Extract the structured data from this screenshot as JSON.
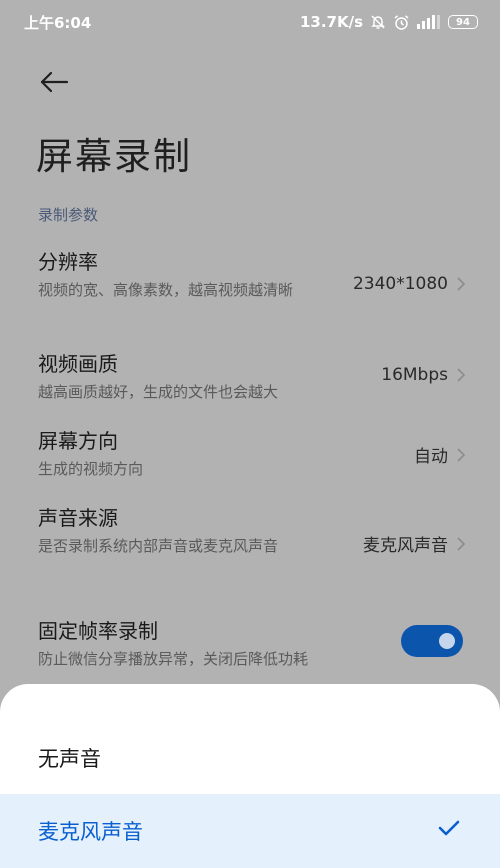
{
  "status_bar": {
    "time": "上午6:04",
    "network_speed": "13.7K/s",
    "battery_level": "94",
    "icons": [
      "muted-bell-icon",
      "alarm-icon",
      "signal-icon",
      "battery-icon"
    ]
  },
  "header": {
    "back_icon": "arrow-left-icon",
    "title": "屏幕录制"
  },
  "section": {
    "label": "录制参数"
  },
  "settings": [
    {
      "title": "分辨率",
      "subtitle": "视频的宽、高像素数，越高视频越清晰",
      "value": "2340*1080"
    },
    {
      "title": "视频画质",
      "subtitle": "越高画质越好，生成的文件也会越大",
      "value": "16Mbps"
    },
    {
      "title": "屏幕方向",
      "subtitle": "生成的视频方向",
      "value": "自动"
    },
    {
      "title": "声音来源",
      "subtitle": "是否录制系统内部声音或麦克风声音",
      "value": "麦克风声音"
    },
    {
      "title": "固定帧率录制",
      "subtitle": "防止微信分享播放异常，关闭后降低功耗",
      "toggle_on": true
    }
  ],
  "sound_source_sheet": {
    "options": [
      {
        "label": "无声音",
        "selected": false
      },
      {
        "label": "麦克风声音",
        "selected": true
      }
    ]
  },
  "colors": {
    "accent": "#0b55ad",
    "selected_text": "#0a5fcf",
    "selected_bg": "#e5f0fd",
    "dim_background": "#b2b2b2"
  }
}
